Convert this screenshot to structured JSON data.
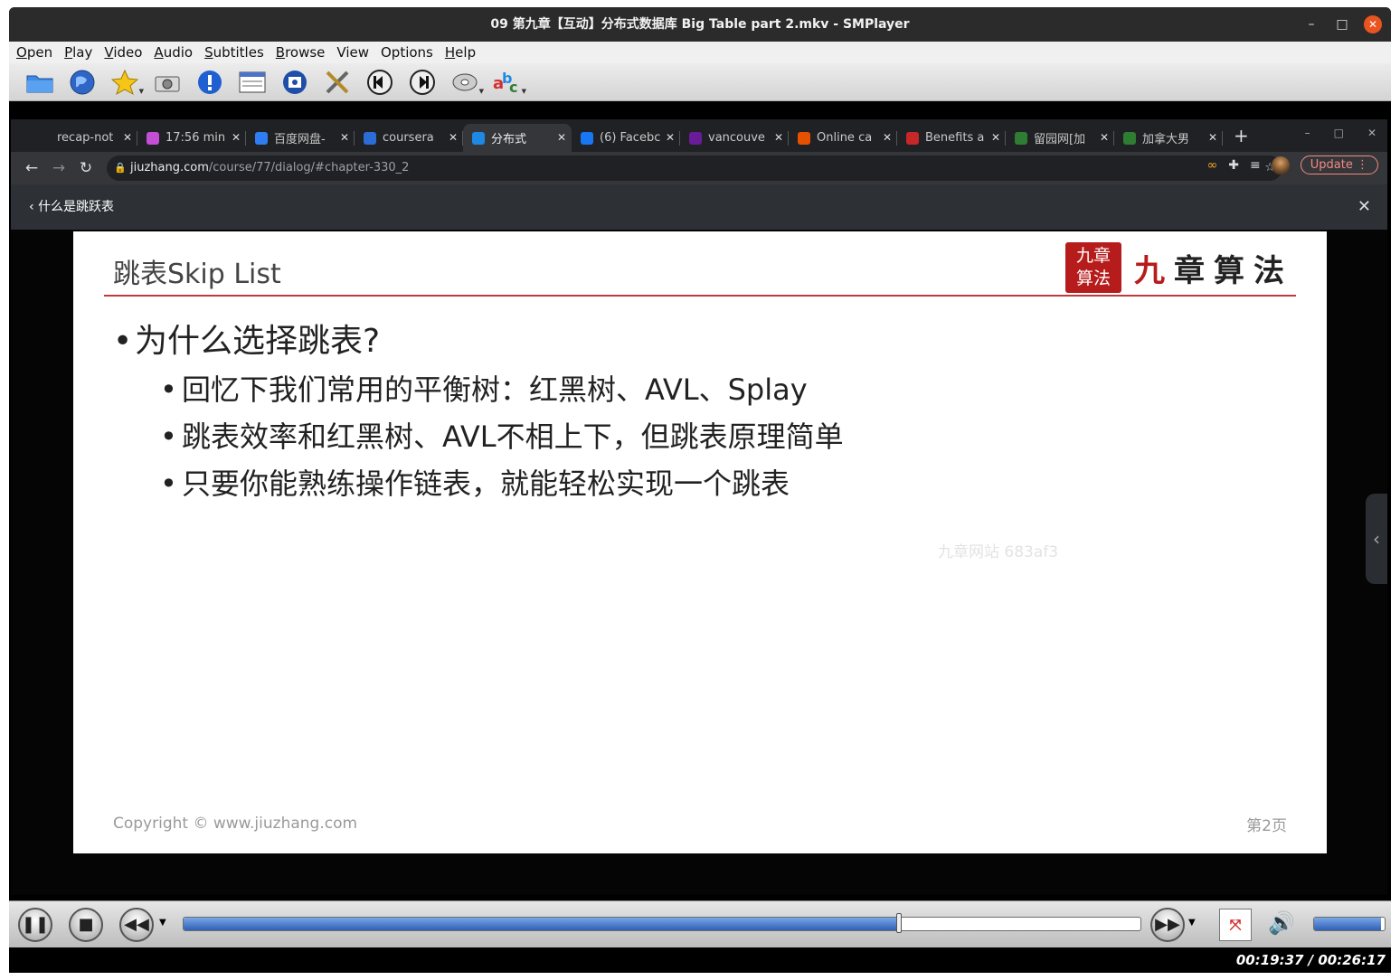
{
  "window": {
    "title": "09 第九章【互动】分布式数据库 Big Table part 2.mkv - SMPlayer"
  },
  "menu": [
    {
      "mn": "O",
      "rest": "pen"
    },
    {
      "mn": "P",
      "rest": "lay"
    },
    {
      "mn": "V",
      "rest": "ideo"
    },
    {
      "mn": "A",
      "rest": "udio"
    },
    {
      "mn": "S",
      "rest": "ubtitles"
    },
    {
      "mn": "B",
      "rest": "rowse"
    },
    {
      "mn": "",
      "rest": "View"
    },
    {
      "mn": "",
      "rest": "Options"
    },
    {
      "mn": "H",
      "rest": "elp"
    }
  ],
  "toolbar_icons": [
    "folder-icon",
    "globe-icon",
    "star-icon",
    "screenshot-icon",
    "info-icon",
    "playlist-icon",
    "preferences-icon",
    "tools-icon",
    "previous-icon",
    "next-icon",
    "disc-icon",
    "subtitles-abc-icon"
  ],
  "browser": {
    "tabs": [
      {
        "label": "recap-not",
        "color": "#202124",
        "icon": "doc-icon",
        "active": false
      },
      {
        "label": "17:56 min",
        "color": "#c44fd6",
        "icon": "timer-icon",
        "active": false
      },
      {
        "label": "百度网盘-",
        "color": "#2e7df2",
        "icon": "cloud-icon",
        "active": false
      },
      {
        "label": "coursera",
        "color": "#2b6cd6",
        "icon": "zhihu-icon",
        "active": false
      },
      {
        "label": "分布式",
        "color": "#1e88e5",
        "icon": "jiuzhang-icon",
        "active": true
      },
      {
        "label": "(6) Facebc",
        "color": "#1877f2",
        "icon": "facebook-icon",
        "active": false
      },
      {
        "label": "vancouve",
        "color": "#6a1b9a",
        "icon": "peace-icon",
        "active": false
      },
      {
        "label": "Online ca",
        "color": "#e65100",
        "icon": "p-icon",
        "active": false
      },
      {
        "label": "Benefits a",
        "color": "#c62828",
        "icon": "maple-icon",
        "active": false
      },
      {
        "label": "留园网[加",
        "color": "#2e7d32",
        "icon": "six-icon",
        "active": false
      },
      {
        "label": "加拿大男",
        "color": "#2e7d32",
        "icon": "six-icon",
        "active": false
      }
    ],
    "url_host": "jiuzhang.com",
    "url_path": "/course/77/dialog/#chapter-330_2",
    "update_label": "Update",
    "dialog_title": "什么是跳跃表"
  },
  "slide": {
    "title": "跳表Skip List",
    "logo_seal": [
      "九章",
      "算法"
    ],
    "logo_text_first": "九",
    "logo_text_rest": "章算法",
    "heading": "为什么选择跳表?",
    "points": [
      "回忆下我们常用的平衡树：红黑树、AVL、Splay",
      "跳表效率和红黑树、AVL不相上下，但跳表原理简单",
      "只要你能熟练操作链表，就能轻松实现一个跳表"
    ],
    "watermark": "九章网站 683af3",
    "copyright": "Copyright © www.jiuzhang.com",
    "page": "第2页"
  },
  "player": {
    "progress_fraction": 0.747,
    "volume_fraction": 0.95,
    "time_display": "00:19:37 / 00:26:17"
  }
}
